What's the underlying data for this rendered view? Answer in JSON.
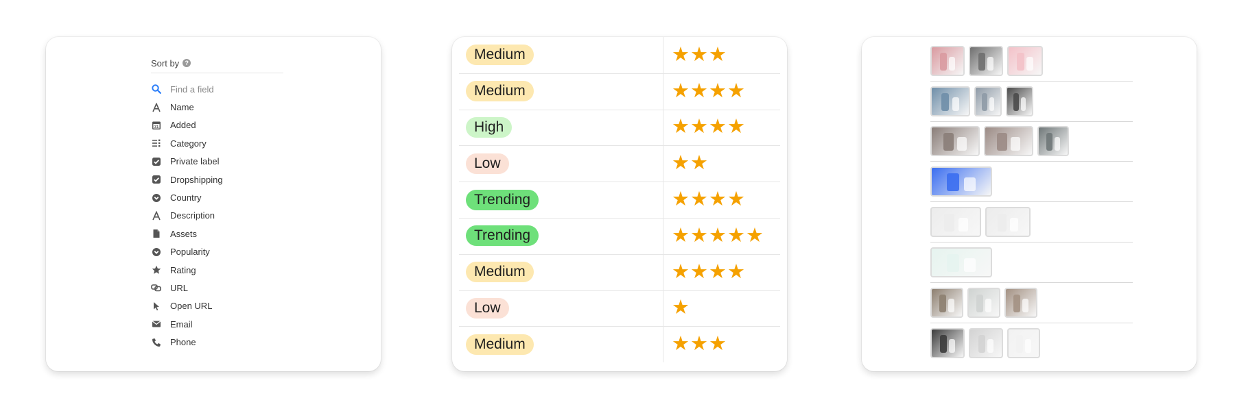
{
  "sort_panel": {
    "header": "Sort by",
    "search_placeholder": "Find a field",
    "fields": [
      {
        "label": "Name",
        "icon": "text-a-icon"
      },
      {
        "label": "Added",
        "icon": "calendar-icon"
      },
      {
        "label": "Category",
        "icon": "multi-select-icon"
      },
      {
        "label": "Private label",
        "icon": "checkbox-icon"
      },
      {
        "label": "Dropshipping",
        "icon": "checkbox-icon"
      },
      {
        "label": "Country",
        "icon": "chevron-circle-icon"
      },
      {
        "label": "Description",
        "icon": "text-a-icon"
      },
      {
        "label": "Assets",
        "icon": "file-icon"
      },
      {
        "label": "Popularity",
        "icon": "chevron-circle-icon"
      },
      {
        "label": "Rating",
        "icon": "star-icon"
      },
      {
        "label": "URL",
        "icon": "link-icon"
      },
      {
        "label": "Open URL",
        "icon": "cursor-icon"
      },
      {
        "label": "Email",
        "icon": "envelope-icon"
      },
      {
        "label": "Phone",
        "icon": "phone-icon"
      }
    ]
  },
  "table_panel": {
    "rows": [
      {
        "popularity": "Medium",
        "rating": 3
      },
      {
        "popularity": "Medium",
        "rating": 4
      },
      {
        "popularity": "High",
        "rating": 4
      },
      {
        "popularity": "Low",
        "rating": 2
      },
      {
        "popularity": "Trending",
        "rating": 4
      },
      {
        "popularity": "Trending",
        "rating": 5
      },
      {
        "popularity": "Medium",
        "rating": 4
      },
      {
        "popularity": "Low",
        "rating": 1
      },
      {
        "popularity": "Medium",
        "rating": 3
      }
    ],
    "pill_colors": {
      "Medium": "#fde8b0",
      "High": "#cdf5c8",
      "Low": "#fbe1d6",
      "Trending": "#6ee07a"
    },
    "star_color": "#f5a100"
  },
  "assets_panel": {
    "rows": [
      [
        {
          "color": "#d99aa0"
        },
        {
          "color": "#6f6f6f"
        },
        {
          "color": "#f3c1c8"
        }
      ],
      [
        {
          "color": "#6f8ea8"
        },
        {
          "color": "#8e9aa6"
        },
        {
          "color": "#4a4a4a"
        }
      ],
      [
        {
          "color": "#8a7d78"
        },
        {
          "color": "#9b8b85"
        },
        {
          "color": "#6f7778"
        }
      ],
      [
        {
          "color": "#3b6ef0"
        }
      ],
      [
        {
          "color": "#ececec"
        },
        {
          "color": "#ececec"
        }
      ],
      [
        {
          "color": "#e6f4ef"
        }
      ],
      [
        {
          "color": "#8d7f70"
        },
        {
          "color": "#cfd3d1"
        },
        {
          "color": "#a39183"
        }
      ],
      [
        {
          "color": "#3c3c3c"
        },
        {
          "color": "#d3d3d3"
        },
        {
          "color": "#f2f2f2"
        }
      ]
    ]
  }
}
